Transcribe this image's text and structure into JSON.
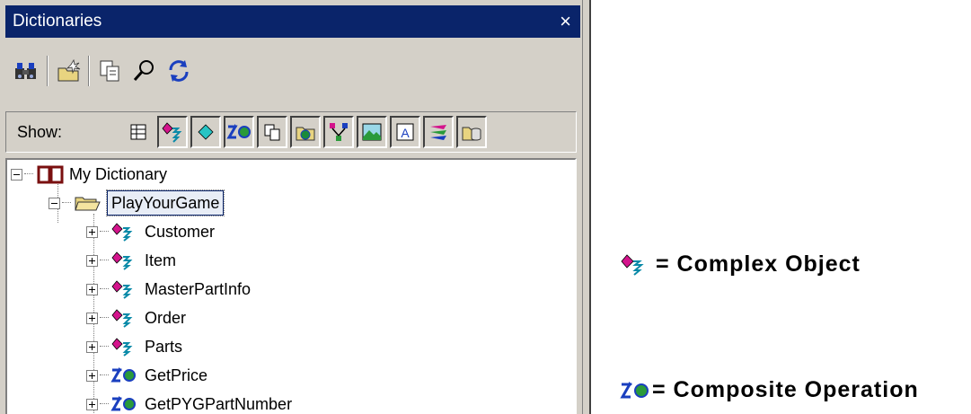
{
  "panel": {
    "title": "Dictionaries",
    "close_glyph": "×",
    "toolbar": [
      "find-icon",
      "new-folder-icon",
      "copy-icon",
      "search-icon",
      "refresh-icon"
    ],
    "show_label": "Show:",
    "show_filters": [
      "table-icon",
      "complex-object-icon",
      "diamond-icon",
      "composite-operation-icon",
      "copy-icon",
      "globe-folder-icon",
      "hierarchy-icon",
      "image-icon",
      "text-icon",
      "layers-icon",
      "database-icon"
    ]
  },
  "tree": {
    "root": {
      "label": "My Dictionary",
      "icon": "book-icon"
    },
    "folder": {
      "label": "PlayYourGame",
      "icon": "folder-open-icon"
    },
    "items": [
      {
        "label": "Customer",
        "icon": "complex-object-icon"
      },
      {
        "label": "Item",
        "icon": "complex-object-icon"
      },
      {
        "label": "MasterPartInfo",
        "icon": "complex-object-icon"
      },
      {
        "label": "Order",
        "icon": "complex-object-icon"
      },
      {
        "label": "Parts",
        "icon": "complex-object-icon"
      },
      {
        "label": "GetPrice",
        "icon": "composite-operation-icon"
      },
      {
        "label": "GetPYGPartNumber",
        "icon": "composite-operation-icon"
      }
    ]
  },
  "legend": [
    {
      "icon": "complex-object-icon",
      "text": "=  Complex Object"
    },
    {
      "icon": "composite-operation-icon",
      "text": "= Composite Operation"
    }
  ],
  "colors": {
    "titlebar": "#0a246a",
    "panel": "#d4d0c8",
    "accent_magenta": "#d4148c",
    "accent_blue": "#1a3fbf"
  }
}
